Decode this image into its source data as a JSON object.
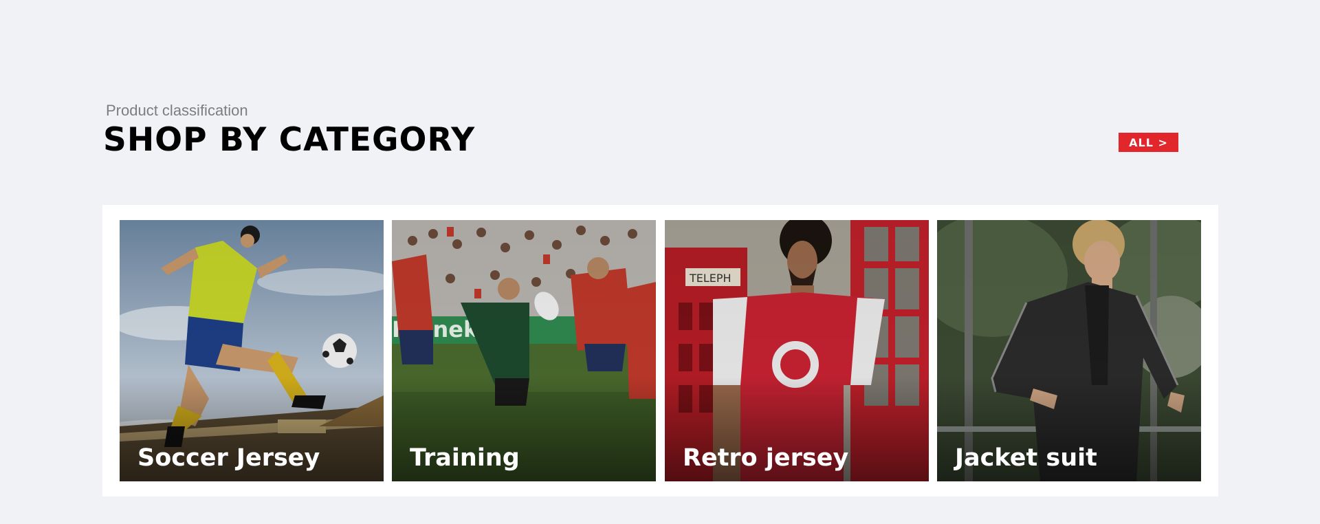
{
  "header": {
    "subtitle": "Product classification",
    "title": "SHOP BY CATEGORY",
    "all_button_label": "ALL >"
  },
  "categories": [
    {
      "label": "Soccer Jersey",
      "image": "soccer-player-kicking-ball-photo"
    },
    {
      "label": "Training",
      "image": "rugby-match-photo"
    },
    {
      "label": "Retro jersey",
      "image": "man-in-red-retro-jersey-photo"
    },
    {
      "label": "Jacket suit",
      "image": "man-in-black-track-jacket-photo"
    }
  ],
  "colors": {
    "page_background": "#f1f2f6",
    "accent": "#e1262c",
    "panel": "#ffffff"
  }
}
